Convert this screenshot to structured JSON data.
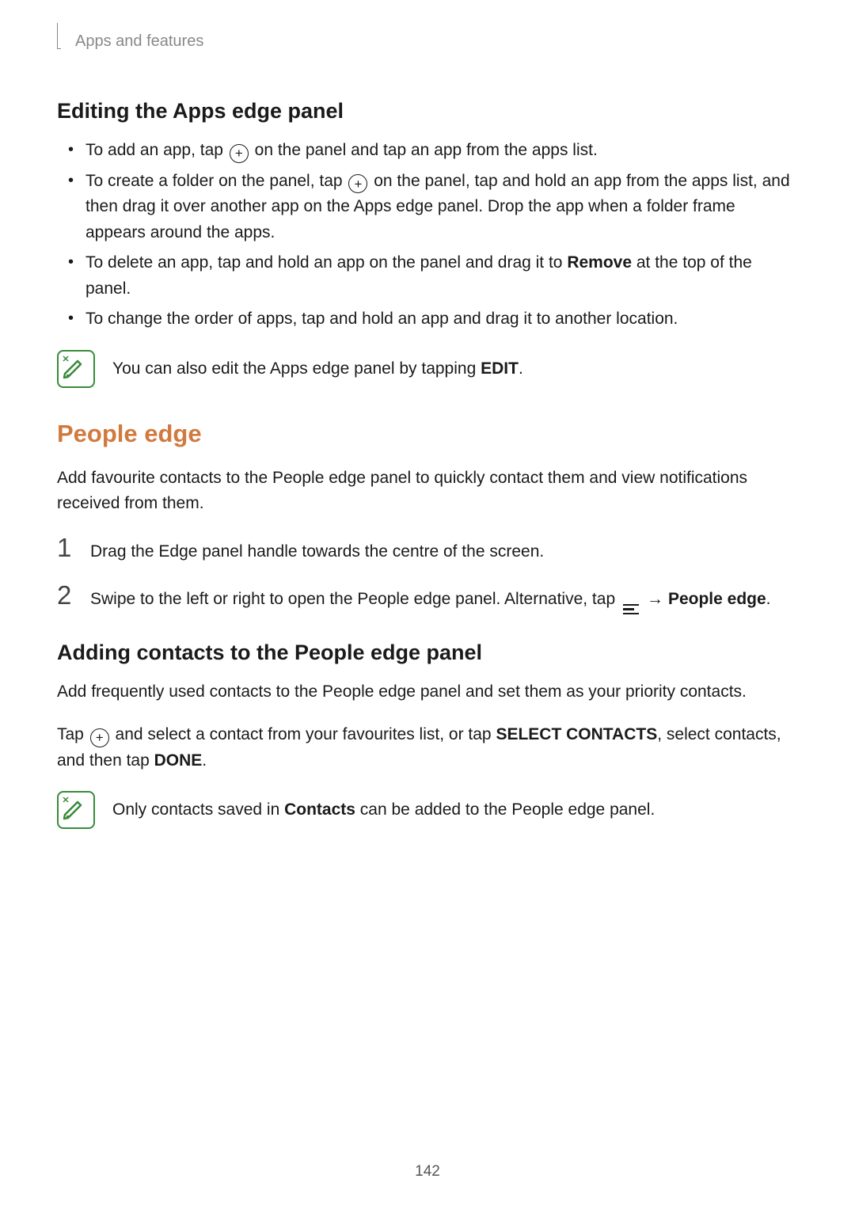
{
  "header": {
    "breadcrumb": "Apps and features"
  },
  "section1": {
    "heading": "Editing the Apps edge panel",
    "bullet1_a": "To add an app, tap ",
    "bullet1_b": " on the panel and tap an app from the apps list.",
    "bullet2_a": "To create a folder on the panel, tap ",
    "bullet2_b": " on the panel, tap and hold an app from the apps list, and then drag it over another app on the Apps edge panel. Drop the app when a folder frame appears around the apps.",
    "bullet3_a": "To delete an app, tap and hold an app on the panel and drag it to ",
    "bullet3_bold": "Remove",
    "bullet3_b": " at the top of the panel.",
    "bullet4": "To change the order of apps, tap and hold an app and drag it to another location.",
    "note_a": "You can also edit the Apps edge panel by tapping ",
    "note_bold": "EDIT",
    "note_b": "."
  },
  "section2": {
    "heading": "People edge",
    "intro": "Add favourite contacts to the People edge panel to quickly contact them and view notifications received from them.",
    "step1_num": "1",
    "step1": "Drag the Edge panel handle towards the centre of the screen.",
    "step2_num": "2",
    "step2_a": "Swipe to the left or right to open the People edge panel. Alternative, tap ",
    "step2_arrow": "→",
    "step2_bold": "People edge",
    "step2_b": "."
  },
  "section3": {
    "heading": "Adding contacts to the People edge panel",
    "intro": "Add frequently used contacts to the People edge panel and set them as your priority contacts.",
    "para2_a": "Tap ",
    "para2_b": " and select a contact from your favourites list, or tap ",
    "para2_bold1": "SELECT CONTACTS",
    "para2_c": ", select contacts, and then tap ",
    "para2_bold2": "DONE",
    "para2_d": ".",
    "note_a": "Only contacts saved in ",
    "note_bold": "Contacts",
    "note_b": " can be added to the People edge panel."
  },
  "footer": {
    "page": "142"
  }
}
